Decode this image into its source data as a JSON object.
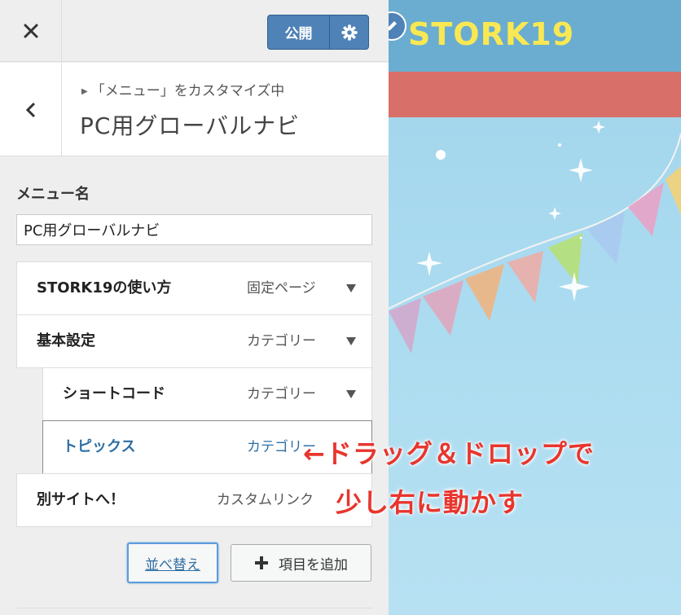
{
  "toolbar": {
    "publish_label": "公開",
    "close_icon": "close-icon",
    "gear_icon": "gear-icon"
  },
  "section": {
    "breadcrumb": "「メニュー」をカスタマイズ中",
    "title": "PC用グローバルナビ"
  },
  "menu_name": {
    "label": "メニュー名",
    "value": "PC用グローバルナビ"
  },
  "menu_items": [
    {
      "title": "STORK19の使い方",
      "type": "固定ページ",
      "depth": 0
    },
    {
      "title": "基本設定",
      "type": "カテゴリー",
      "depth": 0
    },
    {
      "title": "ショートコード",
      "type": "カテゴリー",
      "depth": 1
    },
    {
      "title": "トピックス",
      "type": "カテゴリー",
      "depth": 1
    },
    {
      "title": "別サイトへ！",
      "type": "カスタムリンク",
      "depth": 0
    }
  ],
  "actions": {
    "reorder_label": "並べ替え",
    "add_label": "項目を追加"
  },
  "preview": {
    "logo": "STORK19"
  },
  "annotation": {
    "line1": "←ドラッグ＆ドロップで",
    "line2": "少し右に動かす"
  },
  "colors": {
    "accent": "#4f82b6",
    "link": "#2d6ea3",
    "annotation": "#e8352d",
    "header": "#6aadd0",
    "nav": "#d86f68",
    "logo": "#f9e853"
  }
}
